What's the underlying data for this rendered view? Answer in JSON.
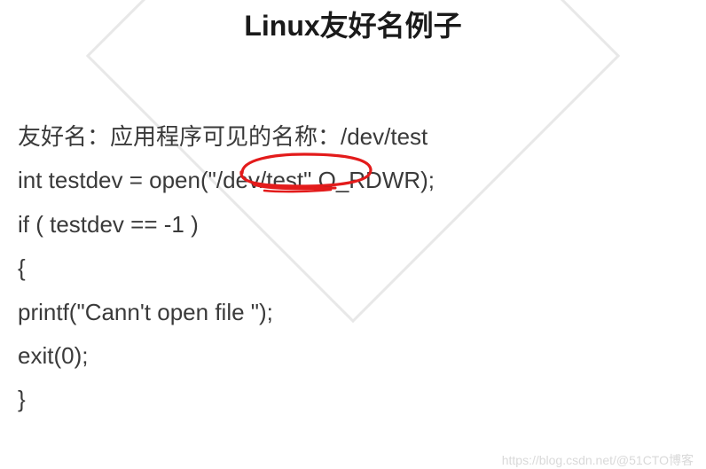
{
  "title": "Linux友好名例子",
  "lines": {
    "l1": "友好名：应用程序可见的名称：/dev/test",
    "l2": "int testdev = open(\"/dev/test\",O_RDWR);",
    "l3": "if ( testdev == -1 )",
    "l4": "{",
    "l5": "printf(\"Cann't open file \");",
    "l6": "exit(0);",
    "l7": "}"
  },
  "watermark": "https://blog.csdn.net/@51CTO博客",
  "annotation": {
    "red_circle_target": "/dev/test",
    "stroke_color": "#e31b1b"
  }
}
